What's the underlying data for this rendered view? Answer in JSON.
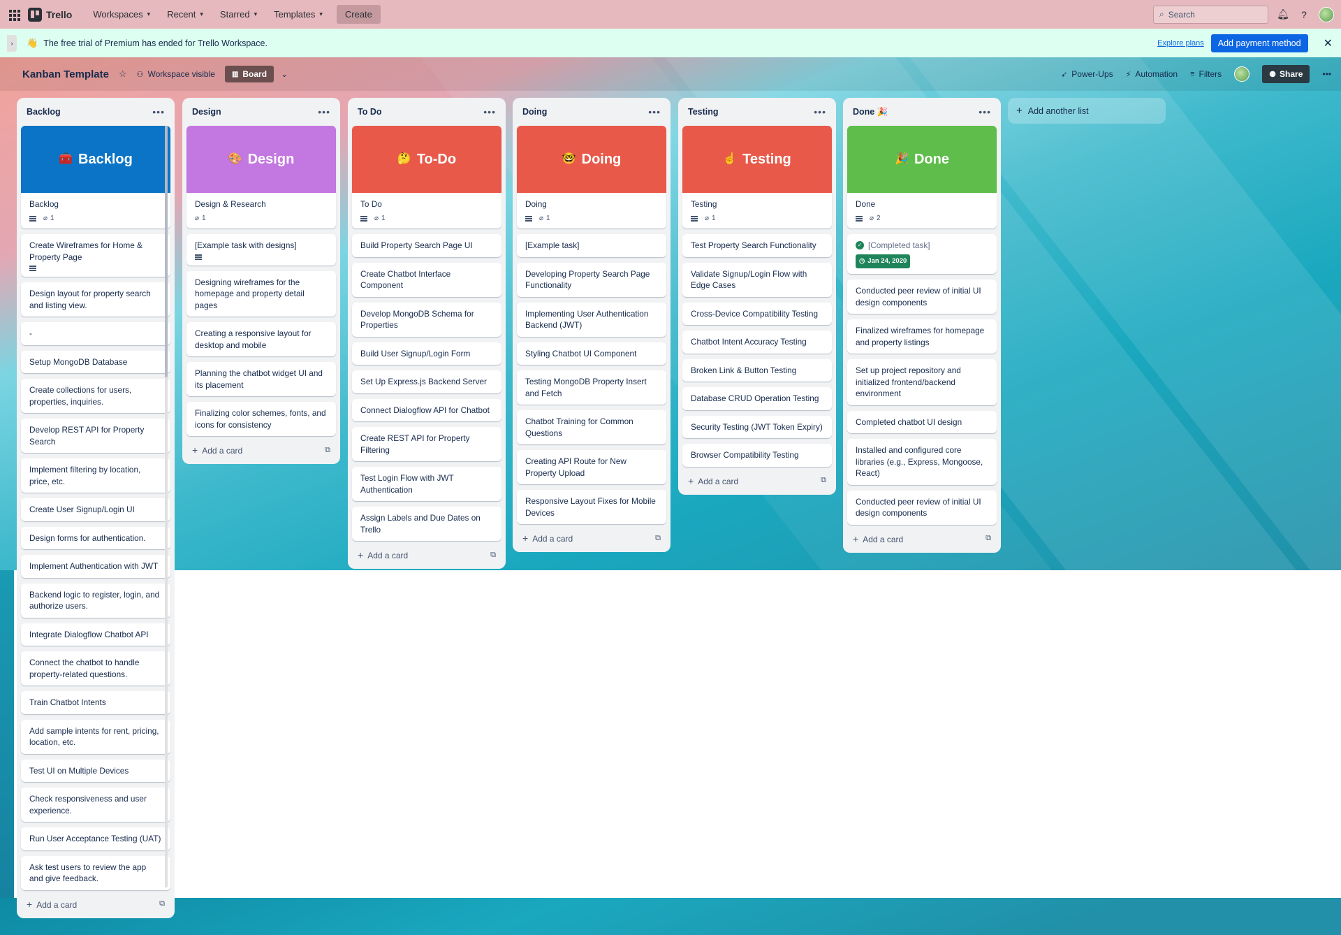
{
  "nav": {
    "logo": "Trello",
    "items": [
      {
        "label": "Workspaces"
      },
      {
        "label": "Recent"
      },
      {
        "label": "Starred"
      },
      {
        "label": "Templates"
      }
    ],
    "create": "Create",
    "search_placeholder": "Search"
  },
  "banner": {
    "text": "The free trial of Premium has ended for Trello Workspace.",
    "explore": "Explore plans",
    "pay": "Add payment method"
  },
  "board": {
    "title": "Kanban Template",
    "visibility": "Workspace visible",
    "view": "Board",
    "powerups": "Power-Ups",
    "automation": "Automation",
    "filters": "Filters",
    "share": "Share",
    "add_list": "Add another list",
    "add_card": "Add a card"
  },
  "lists": [
    {
      "title": "Backlog",
      "cover": {
        "emoji": "🧰",
        "label": "Backlog",
        "color": "#0b74c6"
      },
      "cover_card": {
        "title": "Backlog",
        "desc": true,
        "attachments": "1"
      },
      "cards": [
        "Create Wireframes for Home & Property Page",
        "Design layout for property search and listing view.",
        "-",
        "Setup MongoDB Database",
        "Create collections for users, properties, inquiries.",
        "Develop REST API for Property Search",
        "Implement filtering by location, price, etc.",
        "Create User Signup/Login UI",
        "Design forms for authentication.",
        "Implement Authentication with JWT",
        "Backend logic to register, login, and authorize users.",
        "Integrate Dialogflow Chatbot API",
        "Connect the chatbot to handle property-related questions.",
        "Train Chatbot Intents",
        "Add sample intents for rent, pricing, location, etc.",
        "Test UI on Multiple Devices",
        "Check responsiveness and user experience.",
        "Run User Acceptance Testing (UAT)",
        "Ask test users to review the app and give feedback."
      ]
    },
    {
      "title": "Design",
      "cover": {
        "emoji": "🎨",
        "label": "Design",
        "color": "#c377e0"
      },
      "cover_card": {
        "title": "Design & Research",
        "desc": false,
        "attachments": "1"
      },
      "cards": [
        "[Example task with designs]",
        "Designing wireframes for the homepage and property detail pages",
        "Creating a responsive layout for desktop and mobile",
        "Planning the chatbot widget UI and its placement",
        "Finalizing color schemes, fonts, and icons for consistency"
      ]
    },
    {
      "title": "To Do",
      "cover": {
        "emoji": "🤔",
        "label": "To-Do",
        "color": "#e8594a"
      },
      "cover_card": {
        "title": "To Do",
        "desc": true,
        "attachments": "1"
      },
      "cards": [
        "Build Property Search Page UI",
        "Create Chatbot Interface Component",
        "Develop MongoDB Schema for Properties",
        "Build User Signup/Login Form",
        "Set Up Express.js Backend Server",
        "Connect Dialogflow API for Chatbot",
        "Create REST API for Property Filtering",
        "Test Login Flow with JWT Authentication",
        "Assign Labels and Due Dates on Trello"
      ]
    },
    {
      "title": "Doing",
      "cover": {
        "emoji": "🤓",
        "label": "Doing",
        "color": "#e8594a"
      },
      "cover_card": {
        "title": "Doing",
        "desc": true,
        "attachments": "1"
      },
      "cards": [
        "[Example task]",
        "Developing Property Search Page Functionality",
        "Implementing User Authentication Backend (JWT)",
        "Styling Chatbot UI Component",
        "Testing MongoDB Property Insert and Fetch",
        "Chatbot Training for Common Questions",
        "Creating API Route for New Property Upload",
        "Responsive Layout Fixes for Mobile Devices"
      ]
    },
    {
      "title": "Testing",
      "cover": {
        "emoji": "☝️",
        "label": "Testing",
        "color": "#e8594a"
      },
      "cover_card": {
        "title": "Testing",
        "desc": true,
        "attachments": "1"
      },
      "cards": [
        "Test Property Search Functionality",
        "Validate Signup/Login Flow with Edge Cases",
        "Cross-Device Compatibility Testing",
        "Chatbot Intent Accuracy Testing",
        "Broken Link & Button Testing",
        "Database CRUD Operation Testing",
        "Security Testing (JWT Token Expiry)",
        "Browser Compatibility Testing"
      ]
    },
    {
      "title": "Done 🎉",
      "cover": {
        "emoji": "🎉",
        "label": "Done",
        "color": "#5fbe4b"
      },
      "cover_card": {
        "title": "Done",
        "desc": true,
        "attachments": "2"
      },
      "completed": {
        "label": "[Completed task]",
        "date": "Jan 24, 2020"
      },
      "cards": [
        "Conducted peer review of initial UI design components",
        "Finalized wireframes for homepage and property listings",
        "Set up project repository and initialized frontend/backend environment",
        "Completed chatbot UI design",
        "Installed and configured core libraries (e.g., Express, Mongoose, React)",
        "Conducted peer review of initial UI design components"
      ]
    }
  ]
}
